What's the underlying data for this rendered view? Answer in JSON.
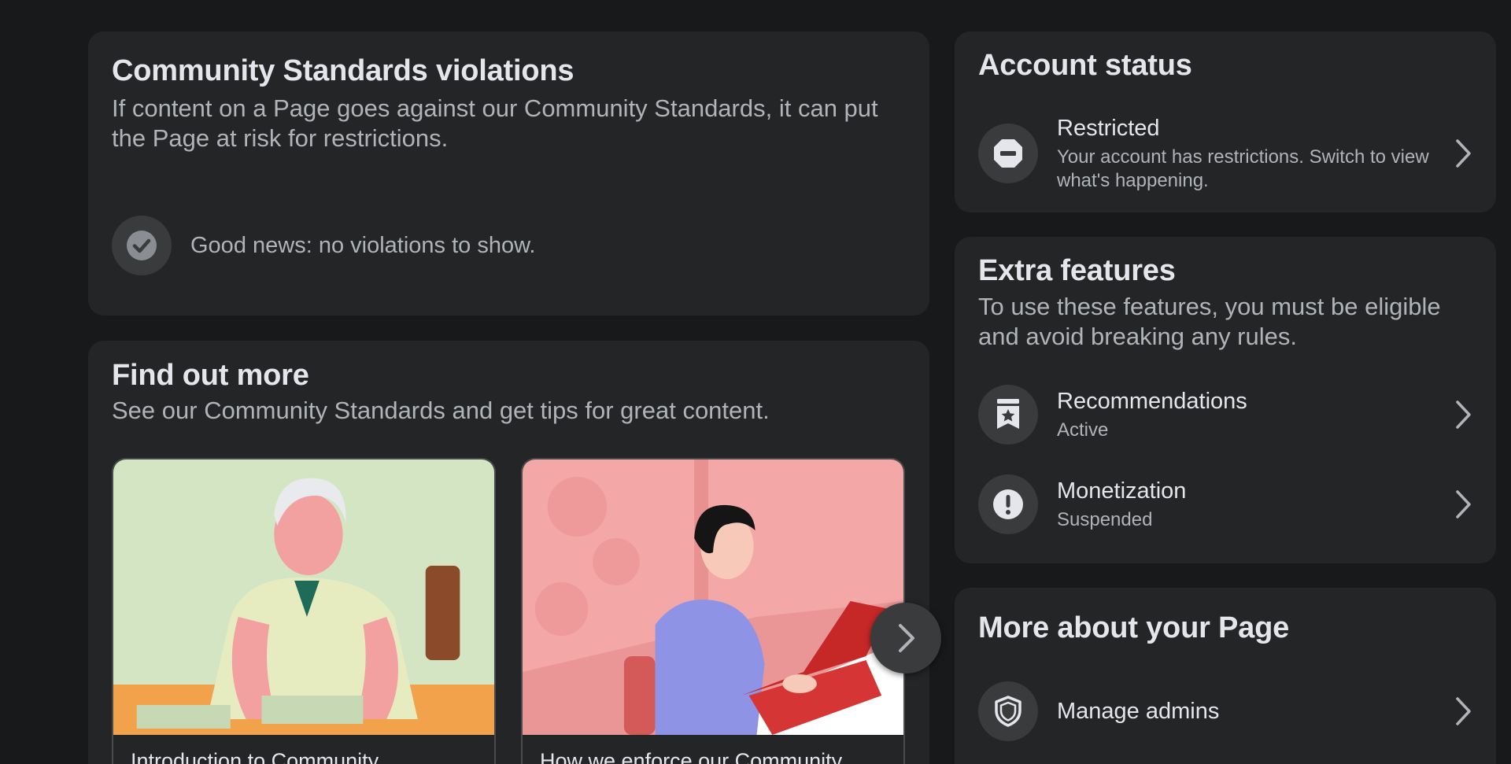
{
  "violations": {
    "title": "Community Standards violations",
    "description": "If content on a Page goes against our Community Standards, it can put the Page at risk for restrictions.",
    "status_text": "Good news: no violations to show."
  },
  "find_out_more": {
    "title": "Find out more",
    "description": "See our Community Standards and get tips for great content.",
    "tiles": [
      {
        "caption": "Introduction to Community"
      },
      {
        "caption": "How we enforce our Community"
      }
    ]
  },
  "account_status": {
    "title": "Account status",
    "item": {
      "label": "Restricted",
      "description": "Your account has restrictions. Switch to view what's happening."
    }
  },
  "extra_features": {
    "title": "Extra features",
    "description": "To use these features, you must be eligible and avoid breaking any rules.",
    "items": [
      {
        "label": "Recommendations",
        "status": "Active"
      },
      {
        "label": "Monetization",
        "status": "Suspended"
      }
    ]
  },
  "more_about_page": {
    "title": "More about your Page",
    "items": [
      {
        "label": "Manage admins"
      }
    ]
  },
  "colors": {
    "background": "#18191a",
    "card": "#242526",
    "icon_circle": "#3a3b3c",
    "primary_text": "#e4e6eb",
    "secondary_text": "#b0b3b8"
  }
}
